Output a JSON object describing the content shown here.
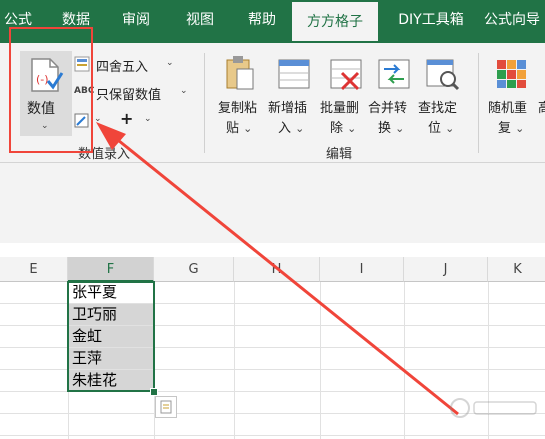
{
  "tabs": [
    "公式",
    "数据",
    "审阅",
    "视图",
    "帮助",
    "方方格子",
    "DIY工具箱",
    "公式向导"
  ],
  "ribbon": {
    "numeric_btn": "数值",
    "round_btn": "四舍五入",
    "keep_btn": "只保留数值",
    "plus_btn": "+",
    "group1_label": "数值录入",
    "copy_paste": [
      "复制粘",
      "贴"
    ],
    "add_insert": [
      "新增插",
      "入"
    ],
    "batch_delete": [
      "批量删",
      "除"
    ],
    "merge_convert": [
      "合并转",
      "换"
    ],
    "find_locate": [
      "查找定",
      "位"
    ],
    "group2_label": "编辑",
    "random_repeat": [
      "随机重",
      "复"
    ],
    "cut_off": "高"
  },
  "columns": [
    "E",
    "F",
    "G",
    "H",
    "I",
    "J",
    "K"
  ],
  "cells_f": [
    "张平夏",
    "卫巧丽",
    "金虹",
    "王萍",
    "朱桂花"
  ],
  "colors": {
    "excel_green": "#217346",
    "annotation_red": "#f0453a"
  }
}
